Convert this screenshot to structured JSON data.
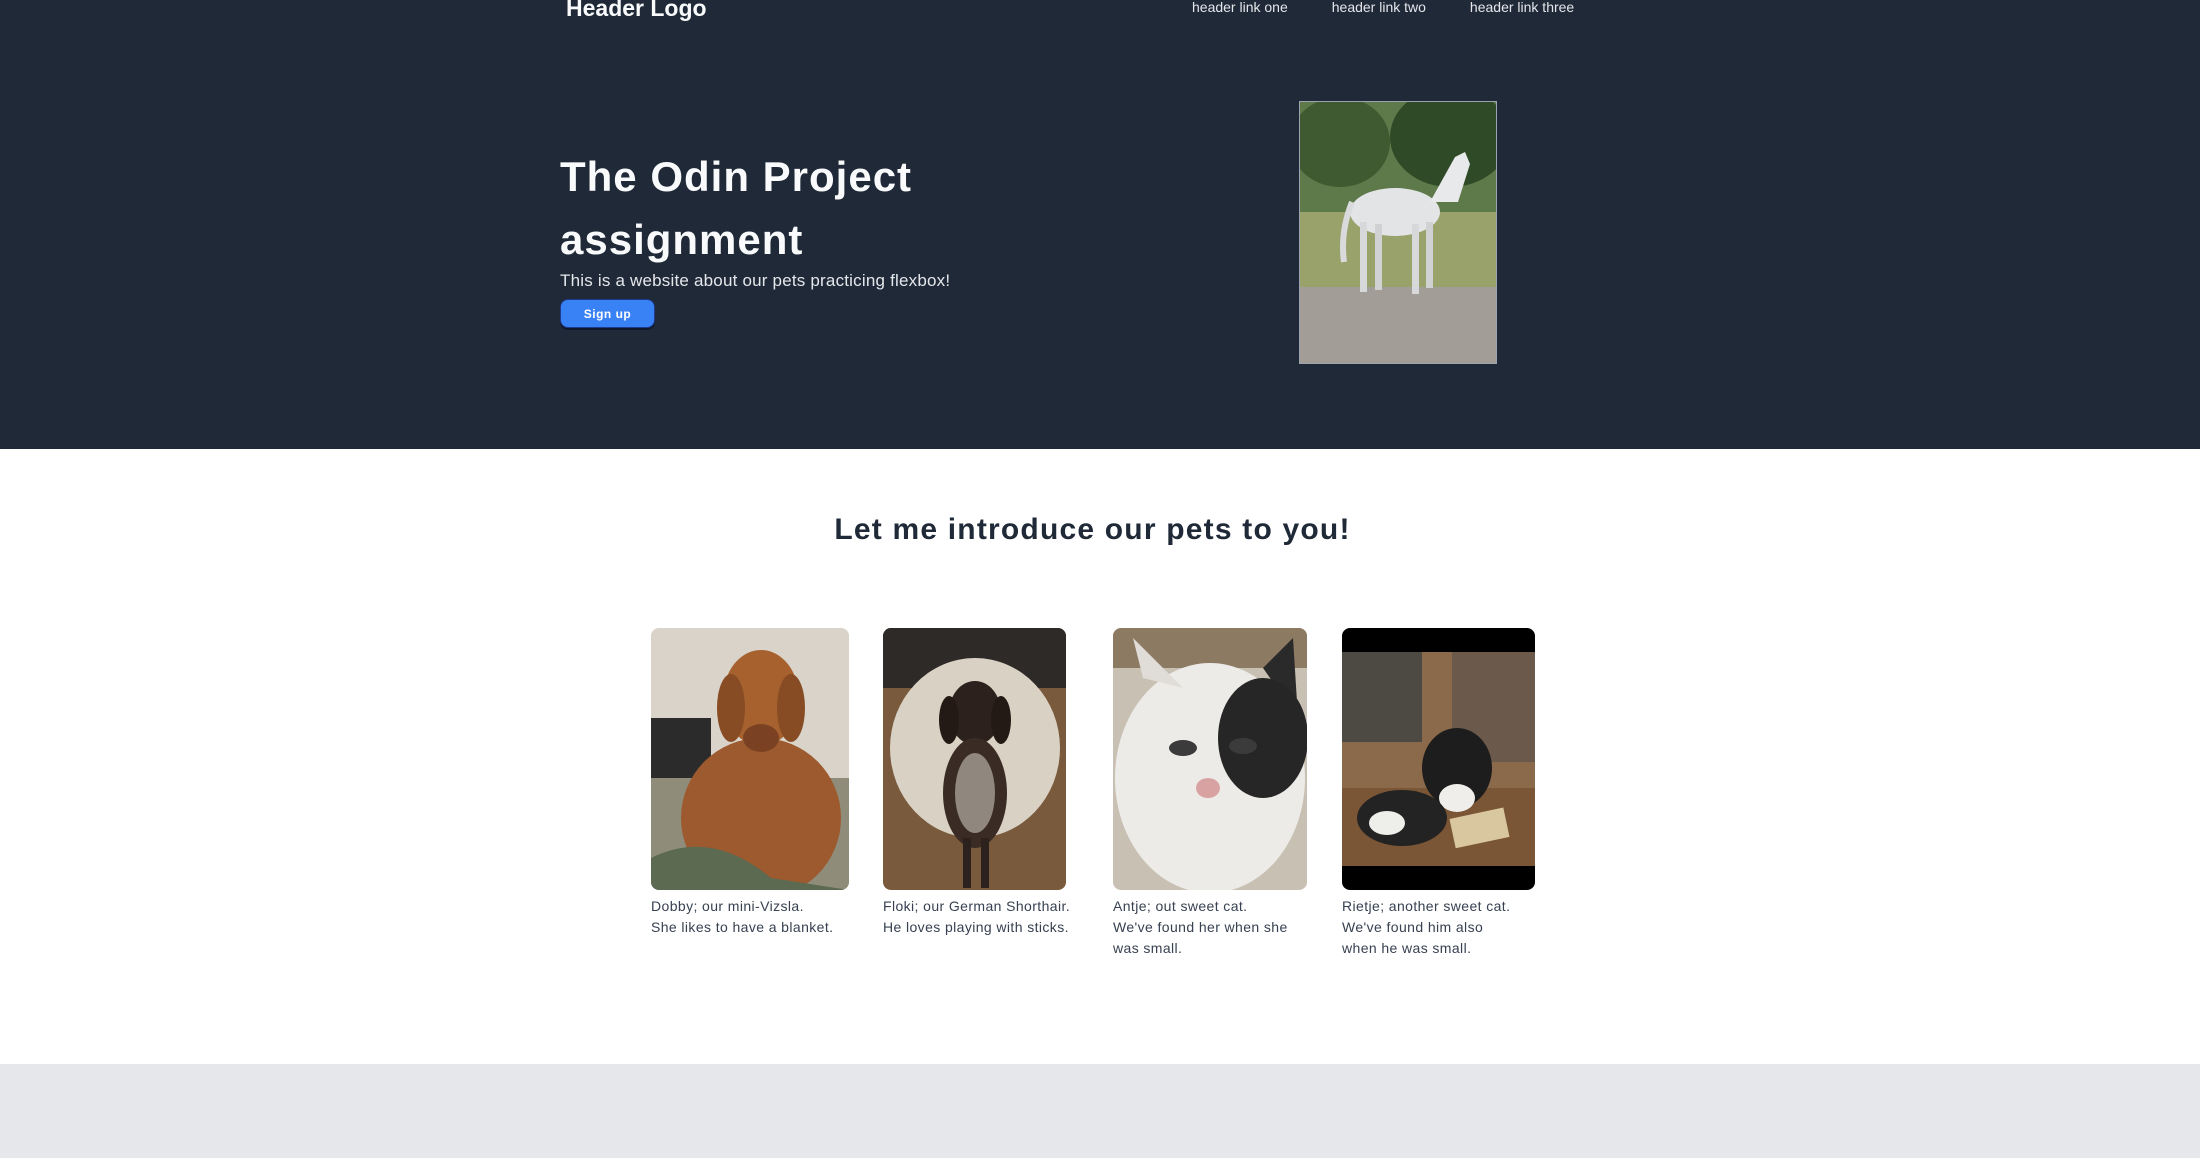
{
  "header": {
    "logo": "Header Logo",
    "links": [
      "header link one",
      "header link two",
      "header link three"
    ]
  },
  "hero": {
    "title": "The Odin Project assignment",
    "subtitle": "This is a website about our pets practicing flexbox!",
    "signup_label": "Sign up"
  },
  "intro": {
    "title": "Let me introduce our pets to you!"
  },
  "pets": [
    {
      "caption_lines": [
        "Dobby; our mini-Vizsla.",
        "She likes to have a blanket."
      ]
    },
    {
      "caption_lines": [
        "Floki; our German Shorthair.",
        "He loves playing with sticks."
      ]
    },
    {
      "caption_lines": [
        "Antje; out sweet cat.",
        "We've found her when she",
        "was small."
      ]
    },
    {
      "caption_lines": [
        "Rietje; another sweet cat.",
        "We've found him also",
        "when he was small."
      ]
    }
  ],
  "colors": {
    "hero_bg": "#1f2937",
    "accent": "#3882f6",
    "footer_bg": "#e5e7eb"
  }
}
